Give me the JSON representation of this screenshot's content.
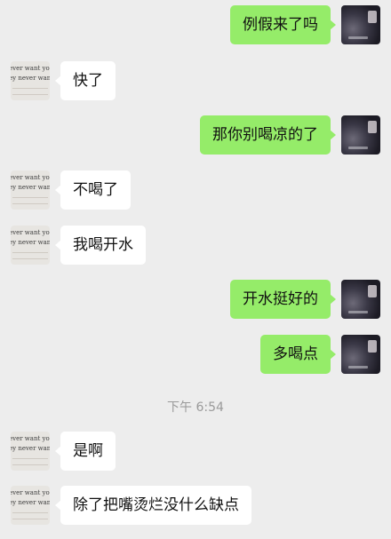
{
  "timestamp": "下午 6:54",
  "peer_avatar_text": [
    "ever want yo",
    "ey never wam"
  ],
  "messages": [
    {
      "from": "self",
      "text": "例假来了吗"
    },
    {
      "from": "peer",
      "text": "快了"
    },
    {
      "from": "self",
      "text": "那你别喝凉的了"
    },
    {
      "from": "peer",
      "text": "不喝了"
    },
    {
      "from": "peer",
      "text": "我喝开水"
    },
    {
      "from": "self",
      "text": "开水挺好的"
    },
    {
      "from": "self",
      "text": "多喝点"
    },
    {
      "from": "peer",
      "text": "是啊"
    },
    {
      "from": "peer",
      "text": "除了把嘴烫烂没什么缺点"
    }
  ],
  "colors": {
    "background": "#ededed",
    "self_bubble": "#95ec69",
    "peer_bubble": "#ffffff",
    "timestamp": "#9a9a9a"
  }
}
